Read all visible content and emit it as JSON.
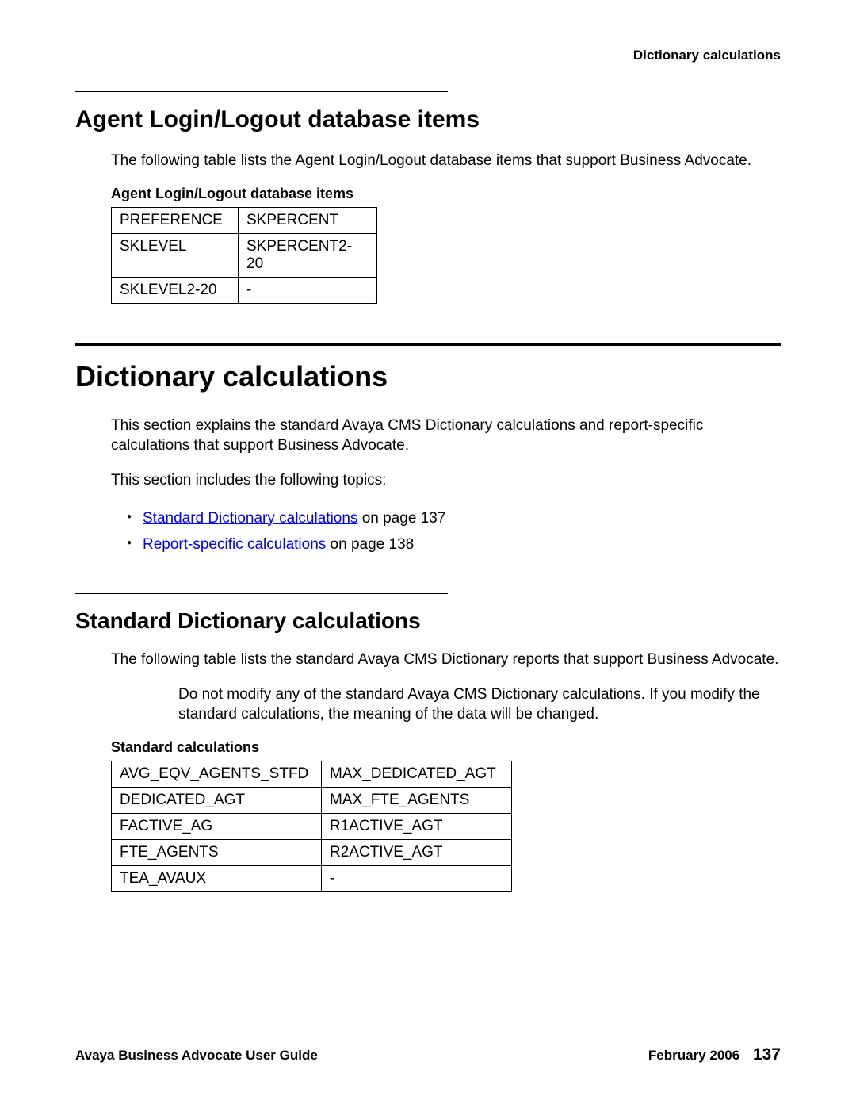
{
  "header": {
    "right": "Dictionary calculations"
  },
  "section1": {
    "title": "Agent Login/Logout database items",
    "intro": "The following table lists the Agent Login/Logout database items that support Business Advocate.",
    "table_title": "Agent Login/Logout database items",
    "rows": [
      [
        "PREFERENCE",
        "SKPERCENT"
      ],
      [
        "SKLEVEL",
        "SKPERCENT2-20"
      ],
      [
        "SKLEVEL2-20",
        "-"
      ]
    ]
  },
  "section2": {
    "title": "Dictionary calculations",
    "intro": "This section explains the standard Avaya CMS Dictionary calculations and report-specific calculations that support Business Advocate.",
    "topics_intro": "This section includes the following topics:",
    "topics": [
      {
        "link": "Standard Dictionary calculations",
        "suffix": " on page 137"
      },
      {
        "link": "Report-specific calculations",
        "suffix": " on page 138"
      }
    ]
  },
  "section3": {
    "title": "Standard Dictionary calculations",
    "intro": "The following table lists the standard Avaya CMS Dictionary reports that support Business Advocate.",
    "note": "Do not modify any of the standard Avaya CMS Dictionary calculations. If you modify the standard calculations, the meaning of the data will be changed.",
    "table_title": "Standard calculations",
    "rows": [
      [
        "AVG_EQV_AGENTS_STFD",
        "MAX_DEDICATED_AGT"
      ],
      [
        "DEDICATED_AGT",
        "MAX_FTE_AGENTS"
      ],
      [
        "FACTIVE_AG",
        "R1ACTIVE_AGT"
      ],
      [
        "FTE_AGENTS",
        "R2ACTIVE_AGT"
      ],
      [
        "TEA_AVAUX",
        "-"
      ]
    ]
  },
  "footer": {
    "left": "Avaya Business Advocate User Guide",
    "date": "February 2006",
    "page": "137"
  }
}
